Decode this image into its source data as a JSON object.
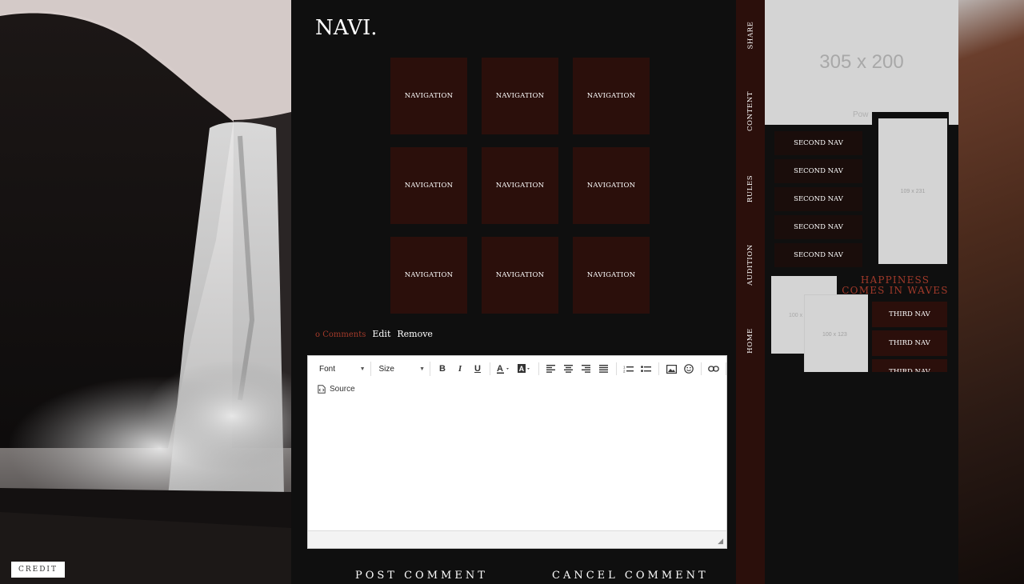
{
  "header": {
    "title": "NAVI."
  },
  "nav_grid": {
    "items": [
      "NAVIGATION",
      "NAVIGATION",
      "NAVIGATION",
      "NAVIGATION",
      "NAVIGATION",
      "NAVIGATION",
      "NAVIGATION",
      "NAVIGATION",
      "NAVIGATION"
    ]
  },
  "comments": {
    "count_label": "o Comments",
    "edit_label": "Edit",
    "remove_label": "Remove"
  },
  "editor": {
    "font_label": "Font",
    "size_label": "Size",
    "source_label": "Source"
  },
  "actions": {
    "post_label": "POST COMMENT",
    "cancel_label": "CANCEL COMMENT"
  },
  "vertical_tabs": [
    "SHARE",
    "CONTENT",
    "RULES",
    "AUDITION",
    "HOME"
  ],
  "sidebar": {
    "banner_label": "305 x 200",
    "banner_sub": "Pow",
    "tall_placeholder_label": "109 x 231",
    "second_nav": [
      "SECOND NAV",
      "SECOND NAV",
      "SECOND NAV",
      "SECOND NAV",
      "SECOND NAV"
    ],
    "tagline": "HAPPINESS COMES IN WAVES",
    "small_placeholder_a": "100 x",
    "small_placeholder_b": "100 x 123",
    "third_nav": [
      "THIRD NAV",
      "THIRD NAV",
      "THIRD NAV"
    ]
  },
  "credit": {
    "label": "CREDIT"
  },
  "colors": {
    "accent_red": "#a23a2a",
    "tile_bg": "#2b0f0b",
    "bg_dark": "#0f0f0f"
  }
}
